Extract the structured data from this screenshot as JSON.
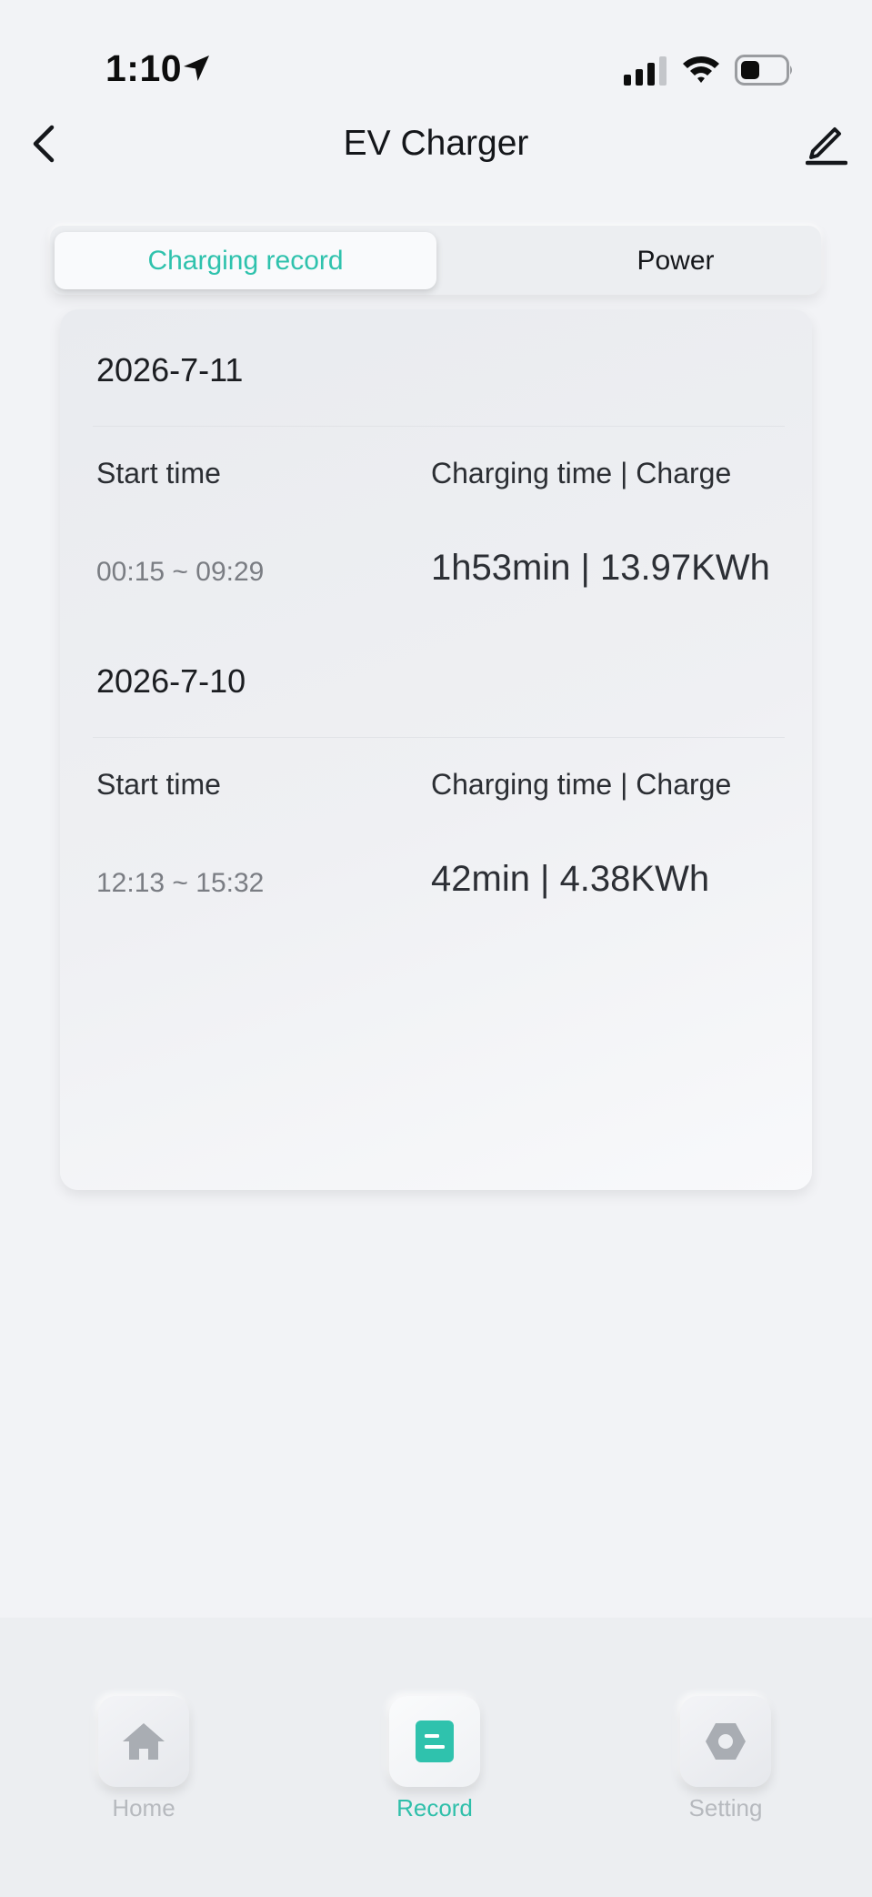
{
  "status_bar": {
    "time": "1:10",
    "icons": [
      "location-arrow-icon",
      "cellular-signal-icon",
      "wifi-icon",
      "battery-icon"
    ]
  },
  "nav": {
    "title": "EV Charger",
    "back_icon": "chevron-left-icon",
    "edit_icon": "pencil-edit-icon"
  },
  "tabs": {
    "active": "Charging record",
    "items": [
      {
        "label": "Charging record",
        "active": true
      },
      {
        "label": "Power",
        "active": false
      }
    ]
  },
  "records": [
    {
      "date": "2026-7-11",
      "start_label": "Start time",
      "charge_label": "Charging time | Charge",
      "time_range": "00:15 ~ 09:29",
      "duration_charge": "1h53min | 13.97KWh"
    },
    {
      "date": "2026-7-10",
      "start_label": "Start time",
      "charge_label": "Charging time | Charge",
      "time_range": "12:13 ~ 15:32",
      "duration_charge": "42min | 4.38KWh"
    }
  ],
  "bottom_nav": {
    "items": [
      {
        "label": "Home",
        "icon": "home-icon",
        "active": false
      },
      {
        "label": "Record",
        "icon": "record-document-icon",
        "active": true
      },
      {
        "label": "Setting",
        "icon": "hexagon-settings-icon",
        "active": false
      }
    ]
  },
  "colors": {
    "accent": "#2fc2ad",
    "background": "#f2f3f6",
    "inactive_tab_label": "#b6b9be"
  }
}
